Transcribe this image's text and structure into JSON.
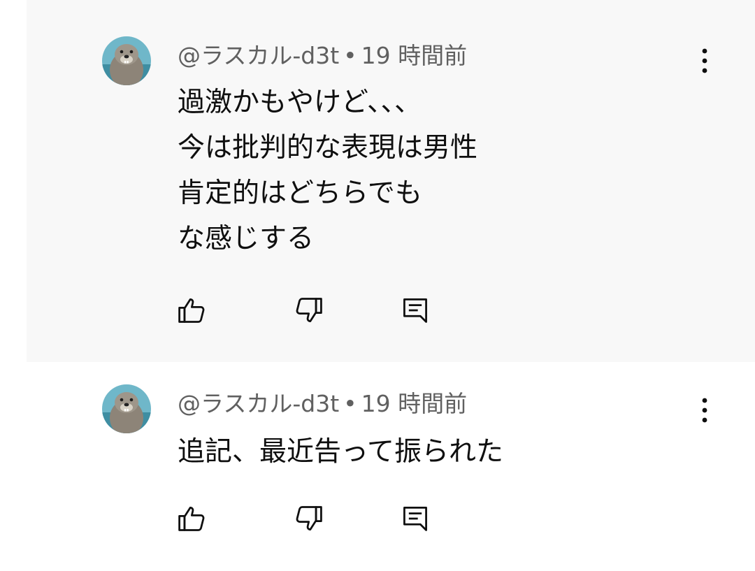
{
  "comments": [
    {
      "author": "@ラスカル-d3t",
      "separator": "•",
      "time": "19 時間前",
      "lines": [
        "過激かもやけど、、、",
        "今は批判的な表現は男性",
        "肯定的はどちらでも",
        "な感じする"
      ],
      "highlighted": true
    },
    {
      "author": "@ラスカル-d3t",
      "separator": "•",
      "time": "19 時間前",
      "lines": [
        "追記、最近告って振られた"
      ],
      "highlighted": false
    }
  ],
  "icons": {
    "like": "thumb-up-icon",
    "dislike": "thumb-down-icon",
    "reply": "reply-comment-icon",
    "more": "more-vert-icon"
  },
  "colors": {
    "highlight_bg": "#f8f8f8",
    "meta_text": "#606060",
    "body_text": "#0f0f0f"
  }
}
